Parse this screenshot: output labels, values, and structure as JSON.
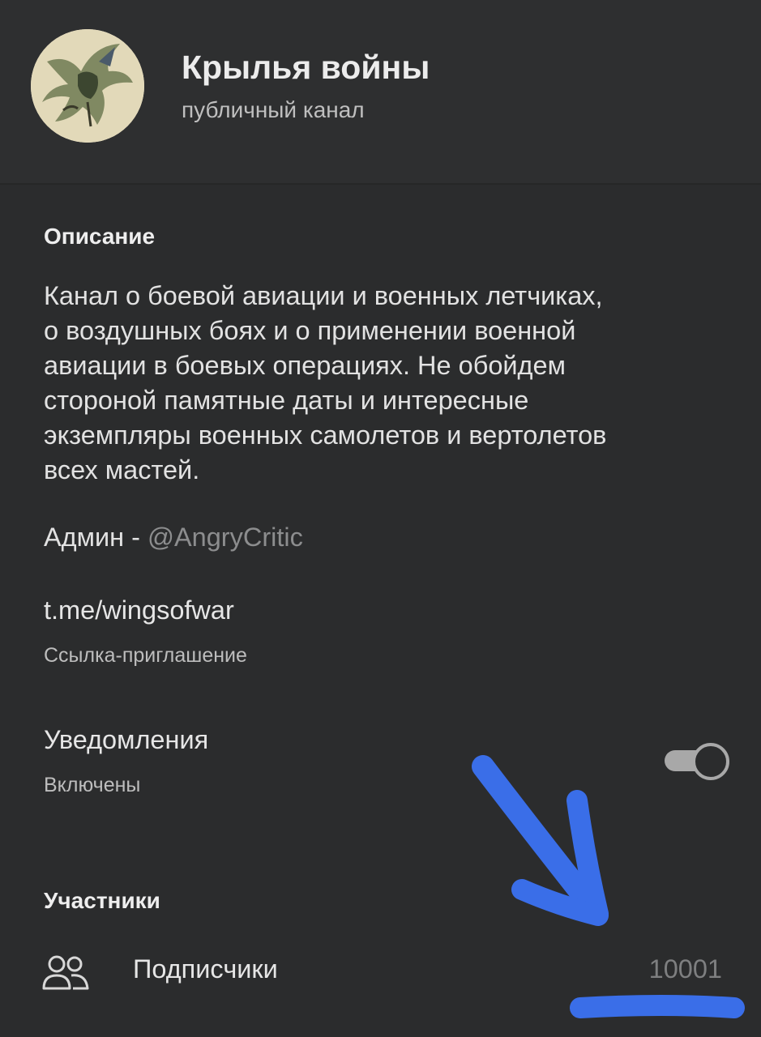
{
  "header": {
    "title": "Крылья войны",
    "subtitle": "публичный канал"
  },
  "description_section": {
    "label": "Описание",
    "text_lines": [
      "Канал о боевой авиации и военных летчиках,",
      "о воздушных боях и о применении военной",
      "авиации в боевых операциях. Не обойдем",
      "стороной памятные даты и интересные",
      "экземпляры военных самолетов и вертолетов",
      "всех мастей."
    ],
    "admin_prefix": "Админ - ",
    "admin_handle": "@AngryCritic"
  },
  "link": {
    "value": "t.me/wingsofwar",
    "caption": "Ссылка-приглашение"
  },
  "notifications": {
    "label": "Уведомления",
    "status": "Включены",
    "enabled": true
  },
  "members_section": {
    "label": "Участники",
    "subscribers_label": "Подписчики",
    "subscribers_count": "10001"
  },
  "colors": {
    "background": "#2b2c2d",
    "annotation_blue": "#3a6ee8",
    "toggle_gray": "#a8a8a8"
  },
  "icons": {
    "avatar": "dragon-avatar",
    "members": "users-icon"
  }
}
